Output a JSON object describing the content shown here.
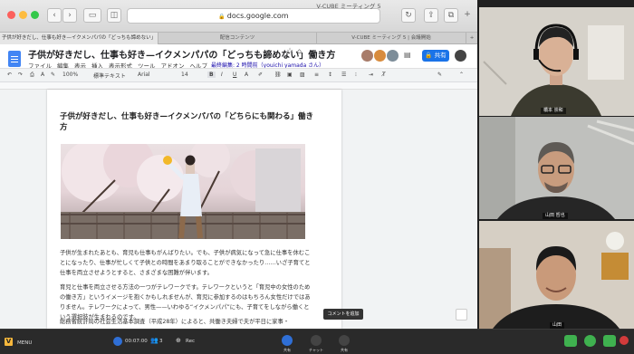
{
  "window": {
    "title": "V-CUBE ミーティング 5"
  },
  "browser": {
    "url": "docs.google.com",
    "tabs": [
      {
        "label": "子供が好きだし、仕事も好き—イクメンパパの「どっちも諦めない」",
        "active": true
      },
      {
        "label": "配信コンテンツ",
        "active": false
      },
      {
        "label": "V-CUBE ミーティング 5 | 会議開始",
        "active": false
      }
    ]
  },
  "docs": {
    "title": "子供が好きだし、仕事も好き—イクメンパパの「どっちも諦めない」働き方",
    "menu": [
      "ファイル",
      "編集",
      "表示",
      "挿入",
      "表示形式",
      "ツール",
      "アドオン",
      "ヘルプ"
    ],
    "last_edit": "最終編集: 2 時間前（youichi yamada さん）",
    "share_label": "共有",
    "toolbar": {
      "zoom": "100%",
      "style": "標準テキスト",
      "font": "Arial",
      "size": "14",
      "bold": "B",
      "italic": "I",
      "underline": "U",
      "text_color": "A"
    },
    "heading": "子供が好きだし、仕事も好き—イクメンパパの「どちらにも関わる」働き方",
    "paragraphs": [
      "子供が生まれたあとも、育児も仕事もがんばりたい。でも、子供が病気になって急に仕事を休むことになったり、仕事が忙しくて子供との時間をあまり取ることができなかったり……いざ子育てと仕事を両立させようとすると、さまざまな困難が伴います。",
      "育児と仕事を両立させる方法の一つがテレワークです。テレワークというと「育児中の女性のための働き方」というイメージを抱くかもしれませんが、育児に参加するのはもちろん女性だけではありません。テレワークによって、男性——いわゆる“イクメンパパ”にも、子育てをしながら働くという選択肢が生まれるのです。",
      "総務省統計局の社会生活基本調査（平成28年）によると、共働き夫婦で夫が平日に家事・"
    ],
    "comment_tooltip": "コメントを追加"
  },
  "participants": [
    {
      "name": "橋本 崇和"
    },
    {
      "name": "山田 哲也"
    },
    {
      "name": "山田"
    }
  ],
  "bottom_bar": {
    "menu_label": "MENU",
    "timer": "00:07:00",
    "participant_count": "3",
    "rec_label": "Rec",
    "share_label": "共有",
    "chat_label": "チャット",
    "other_label": "共有"
  },
  "colors": {
    "brand": "#4285f4",
    "share_blue": "#1a73e8",
    "vcube_green": "#3fb14f",
    "vcube_blue": "#2f6fd6"
  }
}
